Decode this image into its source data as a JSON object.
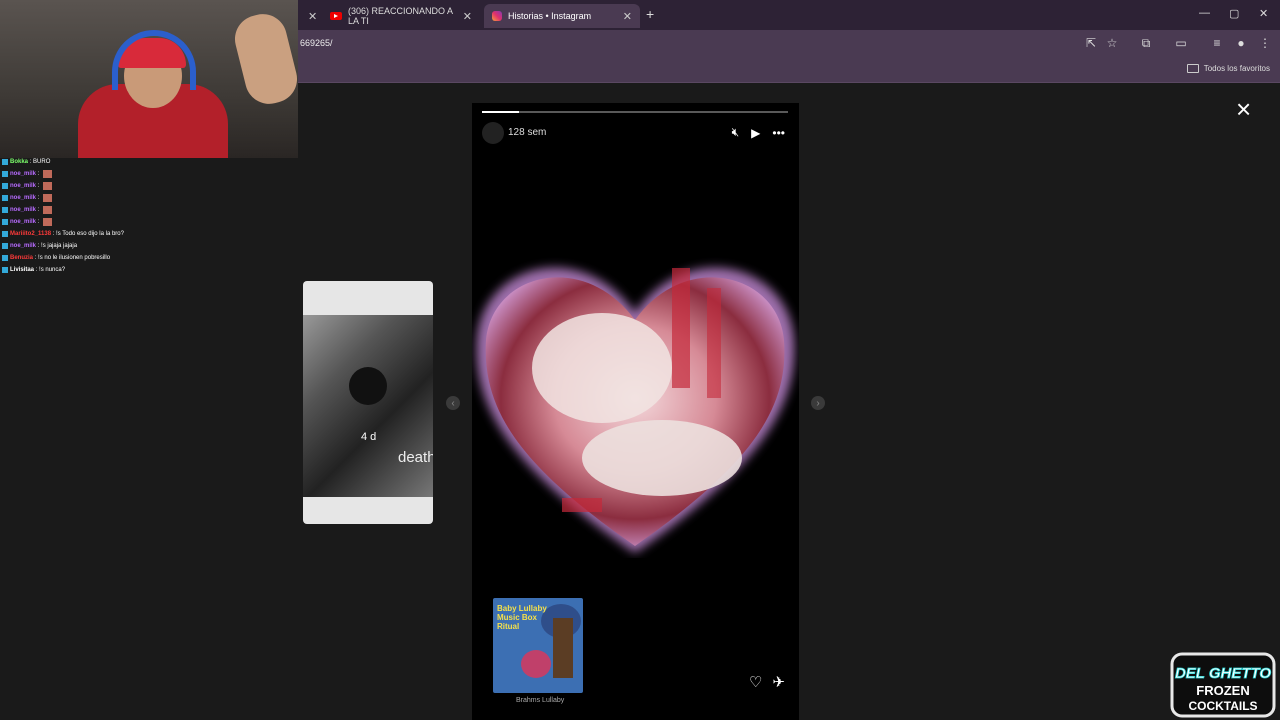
{
  "browser": {
    "tabs": [
      {
        "label": "(306) REACCIONANDO A LA TI"
      },
      {
        "label": "Historias • Instagram"
      }
    ],
    "new_tab": "+",
    "url": "669265/",
    "bookmarks_label": "Todos los favoritos",
    "window_controls": {
      "minimize": "—",
      "maximize": "▢",
      "close": "✕"
    }
  },
  "story": {
    "time_ago": "128 sem",
    "progress_fraction": 0.12,
    "music_card": {
      "title": "Baby Lullaby Music Box Ritual",
      "caption": "Brahms Lullaby"
    },
    "icons": [
      "mute-icon",
      "play-icon",
      "more-icon",
      "heart-icon",
      "share-icon"
    ]
  },
  "prev_story": {
    "time": "4 d",
    "word": "death"
  },
  "stream": {
    "chat": [
      {
        "user": "Bokka",
        "color": "#7cff6b",
        "msg": "BURO"
      },
      {
        "user": "noe_milk",
        "color": "#b76bff",
        "msg": ""
      },
      {
        "user": "noe_milk",
        "color": "#b76bff",
        "msg": ""
      },
      {
        "user": "noe_milk",
        "color": "#b76bff",
        "msg": ""
      },
      {
        "user": "noe_milk",
        "color": "#b76bff",
        "msg": ""
      },
      {
        "user": "noe_milk",
        "color": "#b76bff",
        "msg": ""
      },
      {
        "user": "Mariiito2_1138",
        "color": "#ff3a3a",
        "msg": "!s Todo eso dijo la la bro?"
      },
      {
        "user": "noe_milk",
        "color": "#b76bff",
        "msg": "!s jajaja jajaja"
      },
      {
        "user": "Benuzia",
        "color": "#ff3a3a",
        "msg": "!s no le ilusionen pobresillo"
      },
      {
        "user": "Livisitaa",
        "color": "#ffffff",
        "msg": "!s nunca?"
      }
    ],
    "logo_text": [
      "DEL GHETTO",
      "FROZEN",
      "COCKTAILS"
    ]
  }
}
